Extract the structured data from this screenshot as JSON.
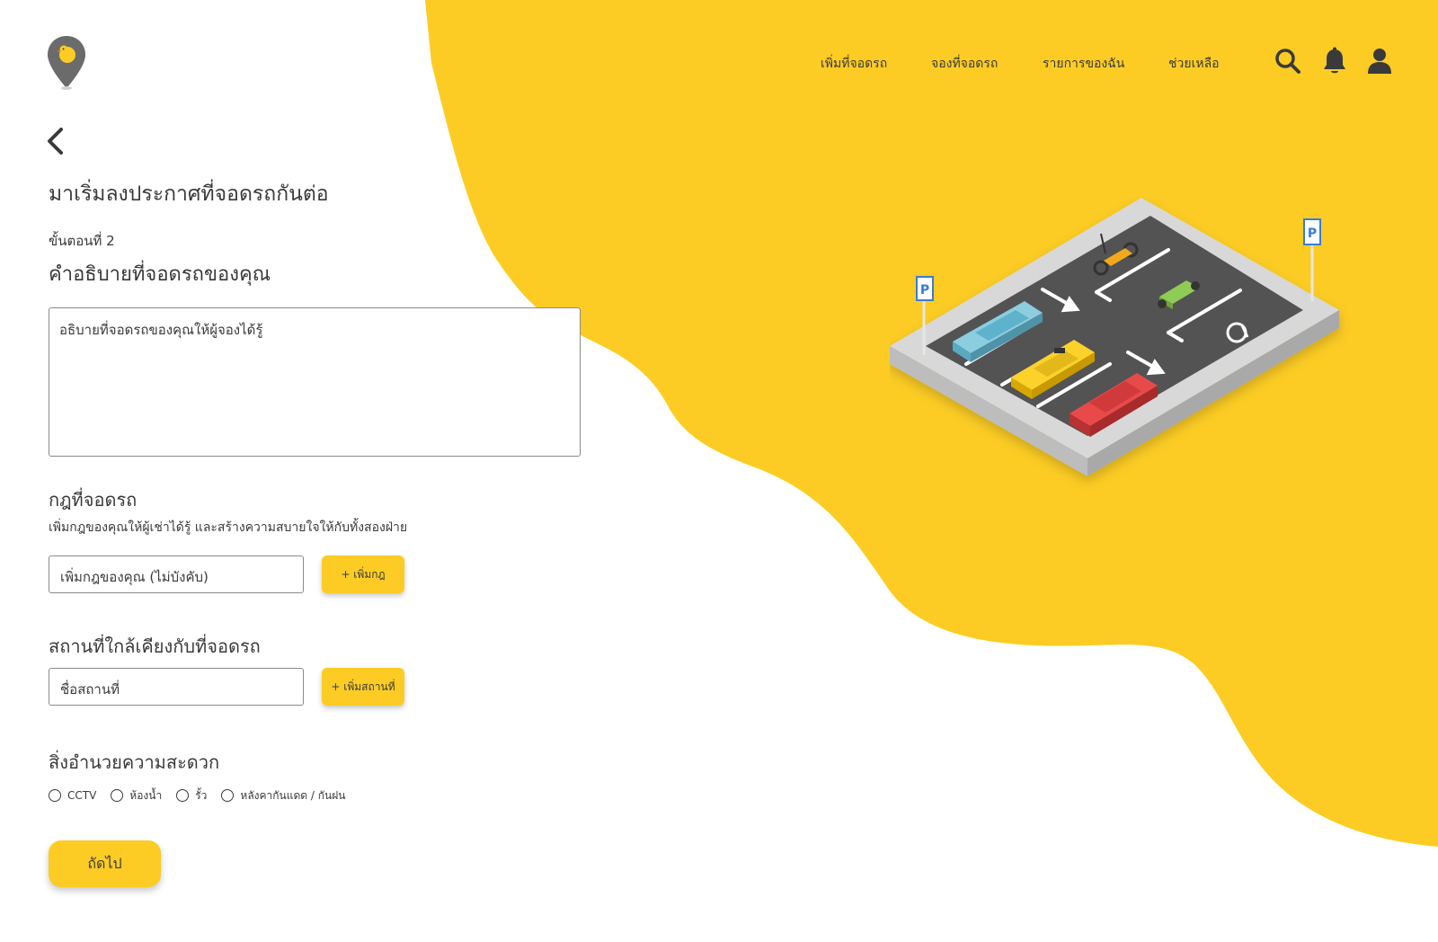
{
  "colors": {
    "accent": "#fccc24",
    "text": "#3a3a3a",
    "border": "#8a8a8a",
    "background": "#ffffff"
  },
  "logo": {
    "icon": "map-pin-chick-icon"
  },
  "nav": {
    "items": [
      {
        "label": "เพิ่มที่จอดรถ"
      },
      {
        "label": "จองที่จอดรถ"
      },
      {
        "label": "รายการของฉัน"
      },
      {
        "label": "ช่วยเหลือ"
      }
    ],
    "icons": [
      "search-icon",
      "bell-icon",
      "user-icon"
    ]
  },
  "page": {
    "title": "มาเริ่มลงประกาศที่จอดรถกันต่อ",
    "step_label": "ขั้นตอนที่ 2",
    "step_title": "คำอธิบายที่จอดรถของคุณ"
  },
  "description": {
    "placeholder": "อธิบายที่จอดรถของคุณให้ผู้จองได้รู้"
  },
  "rules": {
    "title": "กฎที่จอดรถ",
    "subtitle": "เพิ่มกฎของคุณให้ผู้เช่าได้รู้ และสร้างความสบายใจให้กับทั้งสองฝ่าย",
    "input_placeholder": "เพิ่มกฎของคุณ (ไม่บังคับ)",
    "add_label": "+ เพิ่มกฎ"
  },
  "nearby": {
    "title": "สถานที่ใกล้เคียงกับที่จอดรถ",
    "input_placeholder": "ชื่อสถานที่",
    "add_label": "+ เพิ่มสถานที่"
  },
  "amenities": {
    "title": "สิ่งอำนวยความสะดวก",
    "options": [
      {
        "label": "CCTV"
      },
      {
        "label": "ห้องน้ำ"
      },
      {
        "label": "รั้ว"
      },
      {
        "label": "หลังคากันแดด / กันฝน"
      }
    ]
  },
  "actions": {
    "next_label": "ถัดไป"
  }
}
